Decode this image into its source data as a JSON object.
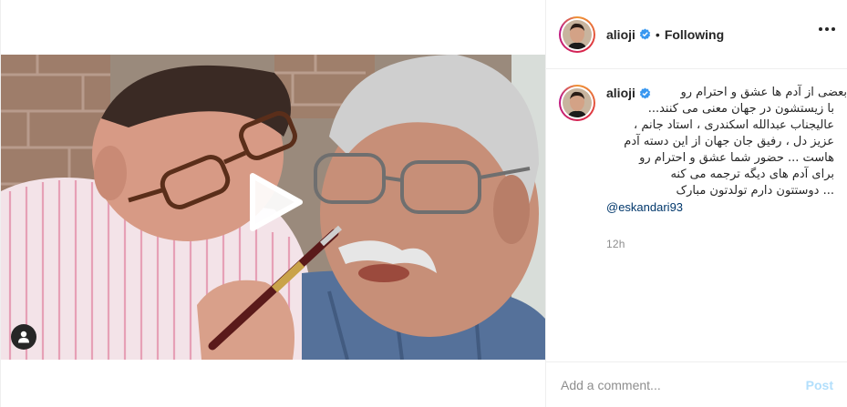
{
  "post": {
    "username": "alioji",
    "separator": "•",
    "follow_status": "Following",
    "more_icon": "more-options-icon",
    "verified_icon": "verified-badge-icon",
    "play_icon": "play-icon",
    "user_tag_icon": "user-tag-icon",
    "colors": {
      "verified": "#3897f0",
      "mention": "#00376b",
      "post_button": "#b2dffc",
      "muted": "#8e8e8e"
    }
  },
  "caption": {
    "username": "alioji",
    "lines": [
      "بعضی از آدم ها عشق و احترام رو",
      "با زیستشون در جهان معنی می کنند...",
      "عالیجناب عبدالله اسکندری ، استاد جانم ،",
      "عزیز دل ، رفیق جان جهان از این دسته آدم",
      "هاست ... حضور شما عشق و احترام رو",
      "برای آدم های دیگه ترجمه می کنه",
      "... دوستتون دارم تولدتون مبارک"
    ],
    "mention": "@eskandari93",
    "timestamp": "12h"
  },
  "comment_box": {
    "placeholder": "Add a comment...",
    "post_label": "Post"
  }
}
